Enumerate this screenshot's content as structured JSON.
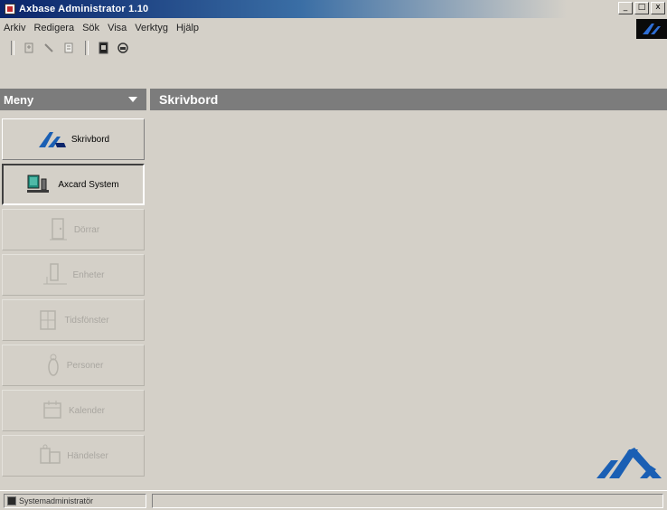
{
  "window": {
    "title": "Axbase Administrator 1.10",
    "buttons": [
      "_",
      "□",
      "x"
    ]
  },
  "menubar": {
    "items": [
      "Arkiv",
      "Redigera",
      "Sök",
      "Visa",
      "Verktyg",
      "Hjälp"
    ]
  },
  "toolbar": {
    "icons": [
      "new-icon",
      "pencil-icon",
      "document-icon",
      "card-icon",
      "printer-icon"
    ]
  },
  "sidebar": {
    "header": "Meny",
    "items": [
      {
        "label": "Skrivbord",
        "icon": "axbase-logo-icon",
        "state": "normal"
      },
      {
        "label": "Axcard System",
        "icon": "computer-card-icon",
        "state": "selected"
      },
      {
        "label": "Dörrar",
        "icon": "door-icon",
        "state": "disabled"
      },
      {
        "label": "Enheter",
        "icon": "device-icon",
        "state": "disabled"
      },
      {
        "label": "Tidsfönster",
        "icon": "clock-icon",
        "state": "disabled"
      },
      {
        "label": "Personer",
        "icon": "person-icon",
        "state": "disabled"
      },
      {
        "label": "Kalender",
        "icon": "calendar-icon",
        "state": "disabled"
      },
      {
        "label": "Händelser",
        "icon": "events-icon",
        "state": "disabled"
      }
    ]
  },
  "main": {
    "header": "Skrivbord"
  },
  "statusbar": {
    "user": "Systemadministratör"
  },
  "colors": {
    "face": "#d4d0c8",
    "header": "#7c7c7c",
    "title_active": "#0a246a",
    "brand_blue": "#1a5fb4"
  }
}
